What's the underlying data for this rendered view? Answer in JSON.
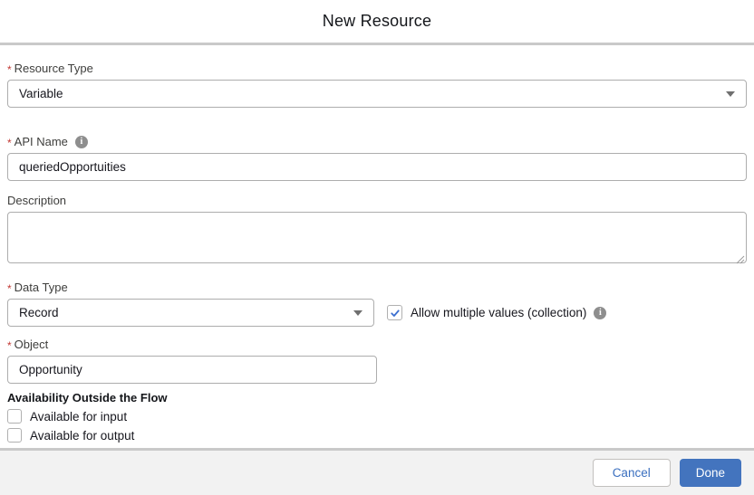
{
  "modal": {
    "title": "New Resource",
    "fields": {
      "resource_type": {
        "label": "Resource Type",
        "required_marker": "*",
        "value": "Variable"
      },
      "api_name": {
        "label": "API Name",
        "required_marker": "*",
        "value": "queriedOpportuities",
        "info_icon": "i"
      },
      "description": {
        "label": "Description",
        "value": ""
      },
      "data_type": {
        "label": "Data Type",
        "required_marker": "*",
        "value": "Record"
      },
      "allow_multiple": {
        "label": "Allow multiple values (collection)",
        "checked": true,
        "info_icon": "i"
      },
      "object": {
        "label": "Object",
        "required_marker": "*",
        "value": "Opportunity"
      },
      "availability": {
        "heading": "Availability Outside the Flow",
        "options": [
          {
            "label": "Available for input",
            "checked": false
          },
          {
            "label": "Available for output",
            "checked": false
          }
        ]
      }
    },
    "footer": {
      "cancel_label": "Cancel",
      "done_label": "Done"
    },
    "colors": {
      "accent_blue": "#4374be",
      "required_red": "#c23934",
      "checkmark_blue": "#3b6fd0",
      "footer_bg": "#f2f2f2",
      "divider": "#c9c9c9"
    },
    "icons": {
      "chevron_down": "triangle-down",
      "info": "circle-i",
      "checkmark": "check",
      "resize_handle": "diagonal-grip"
    }
  }
}
